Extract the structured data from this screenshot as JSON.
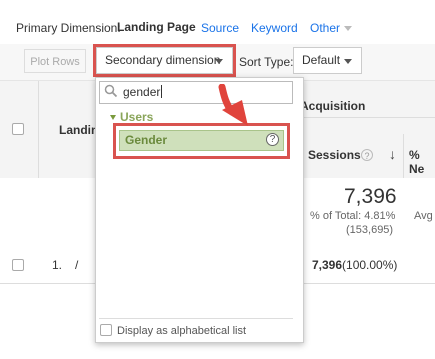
{
  "dimensions": {
    "label": "Primary Dimension:",
    "active": "Landing Page",
    "links": [
      "Source",
      "Keyword",
      "Other"
    ]
  },
  "toolbar": {
    "plot_rows": "Plot Rows",
    "secondary_dimension": "Secondary dimension",
    "sort_type_label": "Sort Type:",
    "sort_type_value": "Default"
  },
  "table": {
    "acquisition_header": "Acquisition",
    "landing_header": "Landin",
    "sessions_header": "Sessions",
    "pct_new_header": "% Ne",
    "totals": {
      "sessions": "7,396",
      "pct_of_total": "% of Total: 4.81%",
      "abs_total": "(153,695)",
      "avg_label": "Avg"
    },
    "rows": [
      {
        "num": "1.",
        "page": "/",
        "sessions": "7,396",
        "sessions_pct": "(100.00%)"
      }
    ]
  },
  "dropdown": {
    "search_value": "gender",
    "group_label": "Users",
    "items": [
      {
        "label": "Gender",
        "help": "?"
      }
    ],
    "alphabetical_label": "Display as alphabetical list"
  },
  "colors": {
    "highlight": "#d9534f",
    "link": "#1a73e8",
    "selected_item_bg": "#cfe0bb",
    "group_text": "#8aa55a"
  }
}
